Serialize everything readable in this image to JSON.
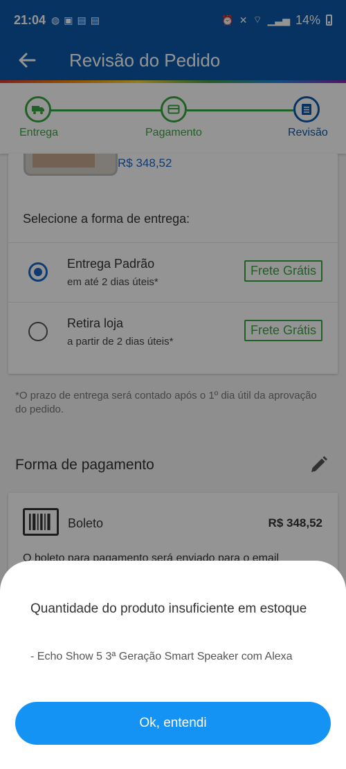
{
  "status_bar": {
    "time": "21:04",
    "notification_icons": [
      "whatsapp-icon",
      "image-icon",
      "app-icon",
      "app-icon"
    ],
    "right_icons": [
      "alarm-icon",
      "mute-icon",
      "wifi-icon",
      "signal-icon"
    ],
    "battery": "14%"
  },
  "app_bar": {
    "back_icon": "arrow-left-icon",
    "title": "Revisão do Pedido"
  },
  "stepper": {
    "steps": [
      {
        "label": "Entrega",
        "icon": "truck-icon",
        "state": "done"
      },
      {
        "label": "Pagamento",
        "icon": "card-icon",
        "state": "done"
      },
      {
        "label": "Revisão",
        "icon": "list-icon",
        "state": "active"
      }
    ],
    "colors": {
      "done": "#3aa640",
      "active": "#0b58a8"
    }
  },
  "product": {
    "price": "R$ 348,52"
  },
  "delivery": {
    "title": "Selecione a forma de entrega:",
    "options": [
      {
        "name": "Entrega Padrão",
        "sub": "em até 2 dias úteis*",
        "badge": "Frete Grátis",
        "selected": true
      },
      {
        "name": "Retira loja",
        "sub": "a partir de 2 dias úteis*",
        "badge": "Frete Grátis",
        "selected": false
      }
    ],
    "note": "*O prazo de entrega será contado após o 1º dia útil da aprovação do pedido."
  },
  "payment": {
    "title": "Forma de pagamento",
    "edit_icon": "pencil-icon",
    "method": "Boleto",
    "method_icon": "barcode-icon",
    "amount": "R$ 348,52",
    "info": "O boleto para pagamento será enviado para o email"
  },
  "dialog": {
    "message": "Quantidade do produto insuficiente em estoque",
    "product": "- Echo Show 5 3ª Geração Smart Speaker com Alexa",
    "button": "Ok, entendi",
    "button_color": "#1593f5"
  }
}
